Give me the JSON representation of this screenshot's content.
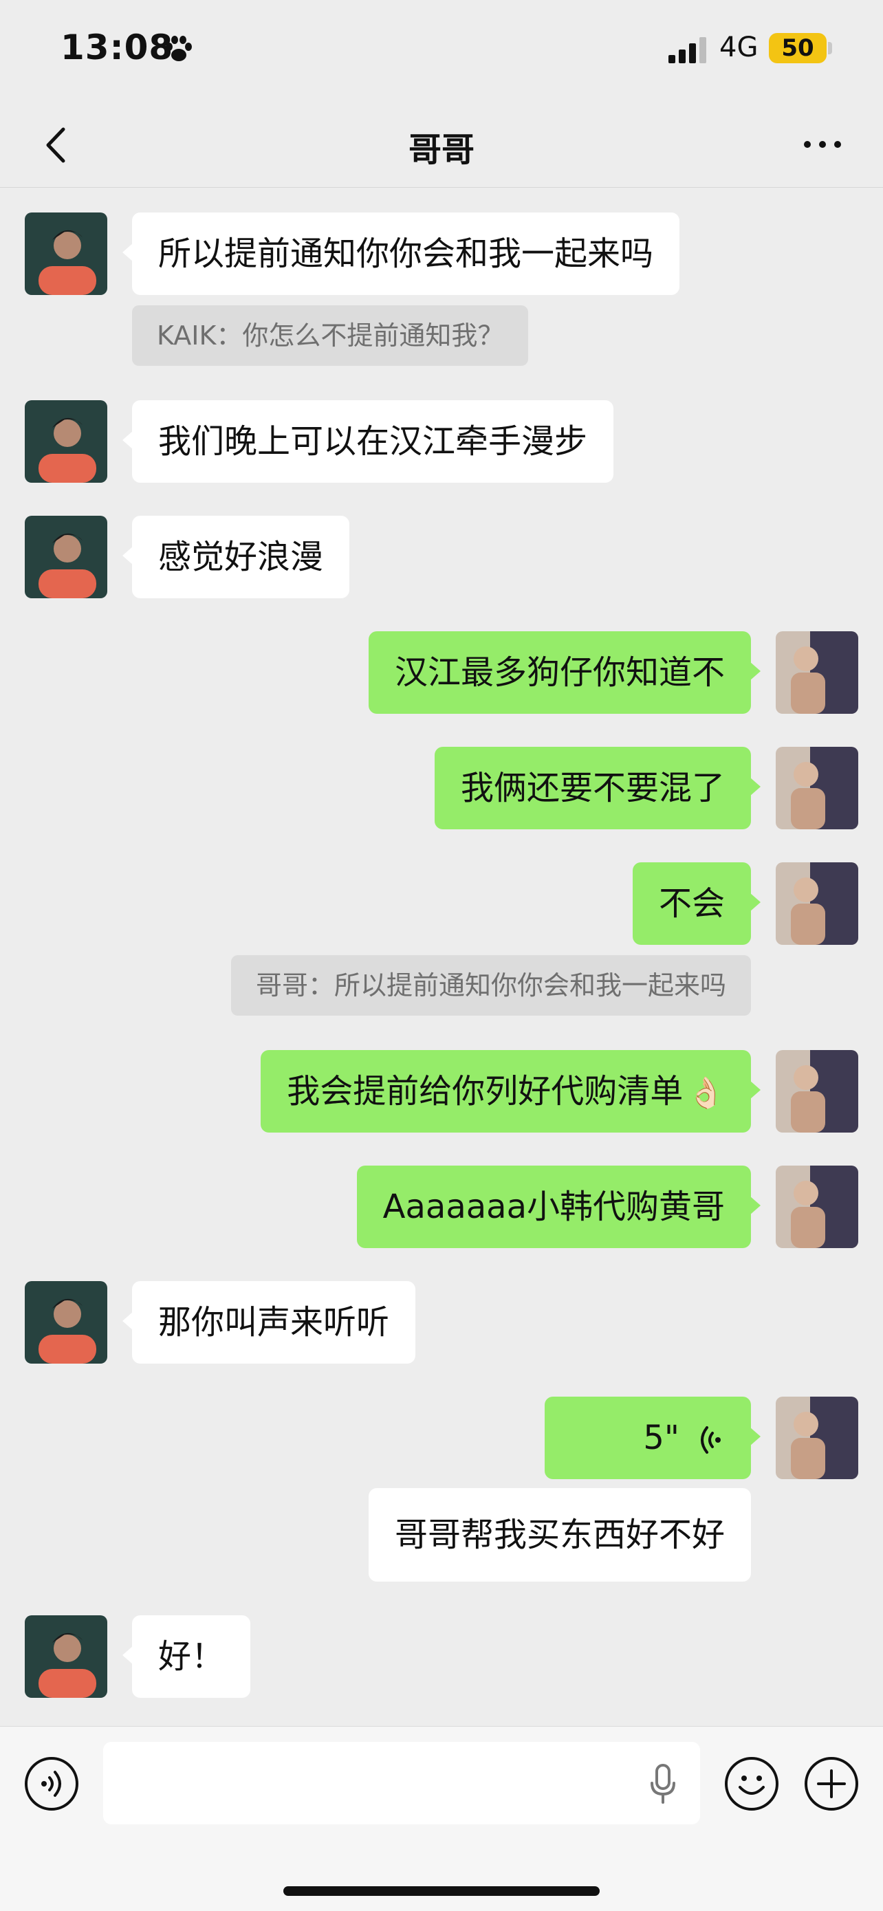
{
  "status": {
    "time": "13:08",
    "network": "4G",
    "battery": "50"
  },
  "header": {
    "title": "哥哥"
  },
  "messages": [
    {
      "side": "in",
      "text": "所以提前通知你你会和我一起来吗"
    },
    {
      "side": "quote",
      "text": "KAIK：你怎么不提前通知我？"
    },
    {
      "side": "in",
      "text": "我们晚上可以在汉江牵手漫步"
    },
    {
      "side": "in",
      "text": "感觉好浪漫"
    },
    {
      "side": "out",
      "text": "汉江最多狗仔你知道不"
    },
    {
      "side": "out",
      "text": "我俩还要不要混了"
    },
    {
      "side": "out",
      "text": "不会"
    },
    {
      "side": "quote",
      "text": "哥哥：所以提前通知你你会和我一起来吗"
    },
    {
      "side": "out",
      "text": "我会提前给你列好代购清单",
      "emoji": "👌🏻"
    },
    {
      "side": "out",
      "text": "Aaaaaaa小韩代购黄哥"
    },
    {
      "side": "in",
      "text": "那你叫声来听听"
    },
    {
      "side": "out",
      "voice": "5\""
    },
    {
      "side": "out-plain",
      "text": "哥哥帮我买东西好不好"
    },
    {
      "side": "in",
      "text": "好！"
    }
  ],
  "input": {
    "placeholder": ""
  },
  "icons": {
    "back": "chevron-left-icon",
    "more": "more-dots-icon",
    "voice_toggle": "voice-icon",
    "mic": "mic-icon",
    "emoji": "emoji-icon",
    "plus": "plus-icon"
  },
  "colors": {
    "background": "#ededed",
    "outgoing_bubble": "#95ec69",
    "incoming_bubble": "#ffffff",
    "battery": "#f3c413"
  }
}
